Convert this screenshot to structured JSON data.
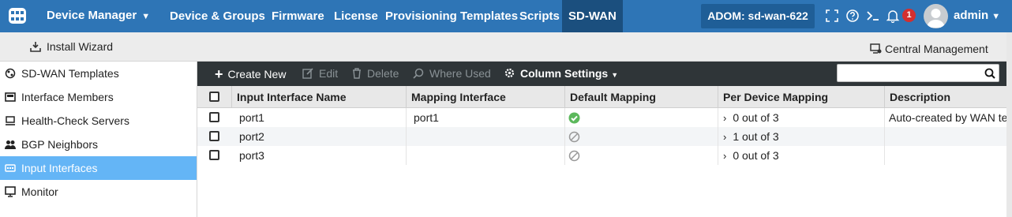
{
  "topbar": {
    "app_title": "Device Manager",
    "nav": [
      {
        "label": "Device & Groups"
      },
      {
        "label": "Firmware"
      },
      {
        "label": "License"
      },
      {
        "label": "Provisioning Templates"
      },
      {
        "label": "Scripts"
      },
      {
        "label": "SD-WAN",
        "active": true
      }
    ],
    "adom": "ADOM: sd-wan-622",
    "notification_count": "1",
    "user": "admin"
  },
  "subbar": {
    "install_wizard": "Install Wizard",
    "central_management": "Central Management"
  },
  "sidebar": {
    "items": [
      {
        "label": "SD-WAN Templates",
        "icon": "templates-icon"
      },
      {
        "label": "Interface Members",
        "icon": "interface-members-icon"
      },
      {
        "label": "Health-Check Servers",
        "icon": "monitor-server-icon"
      },
      {
        "label": "BGP Neighbors",
        "icon": "users-icon"
      },
      {
        "label": "Input Interfaces",
        "icon": "network-icon",
        "active": true
      },
      {
        "label": "Monitor",
        "icon": "monitor-icon"
      }
    ]
  },
  "toolbar": {
    "create_new": "Create New",
    "edit": "Edit",
    "delete": "Delete",
    "where_used": "Where Used",
    "column_settings": "Column Settings",
    "search_placeholder": ""
  },
  "table": {
    "columns": [
      "Input Interface Name",
      "Mapping Interface",
      "Default Mapping",
      "Per Device Mapping",
      "Description"
    ],
    "rows": [
      {
        "name": "port1",
        "mapping": "port1",
        "default_mapping": "enabled",
        "per_device": "0 out of 3",
        "description": "Auto-created by WAN te"
      },
      {
        "name": "port2",
        "mapping": "",
        "default_mapping": "disabled",
        "per_device": "1 out of 3",
        "description": ""
      },
      {
        "name": "port3",
        "mapping": "",
        "default_mapping": "disabled",
        "per_device": "0 out of 3",
        "description": ""
      }
    ]
  },
  "colors": {
    "topbar": "#2e75b6",
    "nav_active": "#1b4f7e",
    "toolbar": "#2f3538",
    "sidebar_active": "#64b5f6",
    "check_green": "#5cb85c",
    "badge_red": "#d32f2f"
  }
}
